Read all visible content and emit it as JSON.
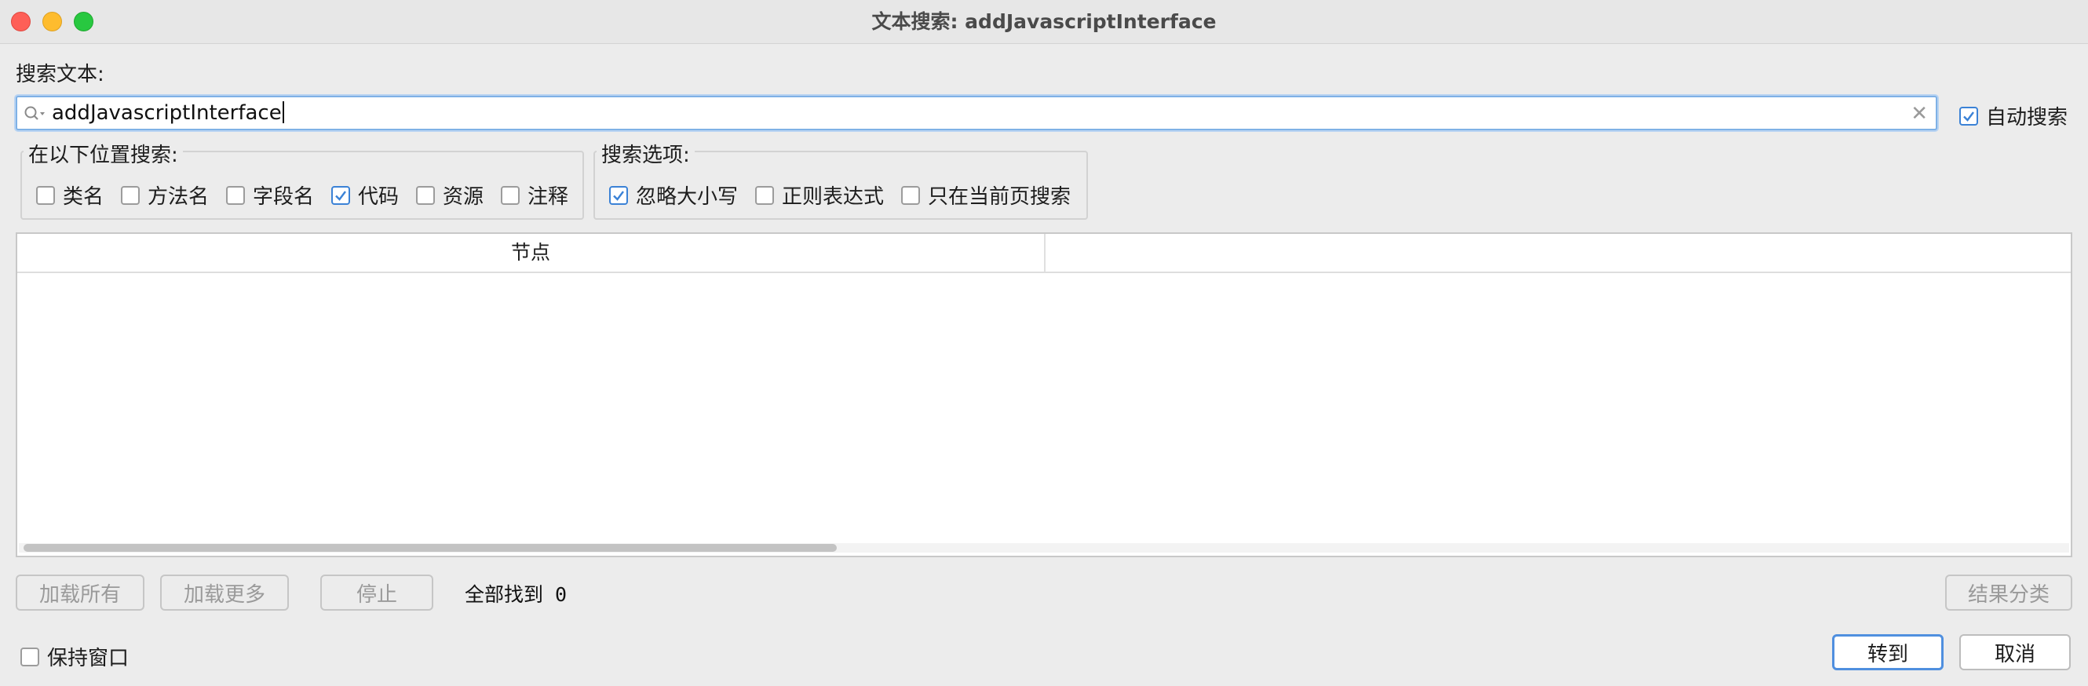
{
  "window": {
    "title": "文本搜索: addJavascriptInterface"
  },
  "search": {
    "label": "搜索文本:",
    "value": "addJavascriptInterface",
    "auto_search": {
      "label": "自动搜索",
      "checked": true
    }
  },
  "search_in": {
    "legend": "在以下位置搜索:",
    "options": [
      {
        "label": "类名",
        "checked": false
      },
      {
        "label": "方法名",
        "checked": false
      },
      {
        "label": "字段名",
        "checked": false
      },
      {
        "label": "代码",
        "checked": true
      },
      {
        "label": "资源",
        "checked": false
      },
      {
        "label": "注释",
        "checked": false
      }
    ]
  },
  "search_options": {
    "legend": "搜索选项:",
    "options": [
      {
        "label": "忽略大小写",
        "checked": true
      },
      {
        "label": "正则表达式",
        "checked": false
      },
      {
        "label": "只在当前页搜索",
        "checked": false
      }
    ]
  },
  "results": {
    "columns": [
      "节点",
      ""
    ]
  },
  "footer": {
    "load_all": "加载所有",
    "load_more": "加载更多",
    "stop": "停止",
    "found_text": "全部找到 0",
    "sort_results": "结果分类",
    "keep_window": {
      "label": "保持窗口",
      "checked": false
    },
    "goto": "转到",
    "cancel": "取消"
  },
  "colors": {
    "accent": "#3b82d6",
    "focus_ring": "#7fb1e6",
    "close": "#fe5f57",
    "minimize": "#febc2e",
    "maximize": "#28c840"
  }
}
